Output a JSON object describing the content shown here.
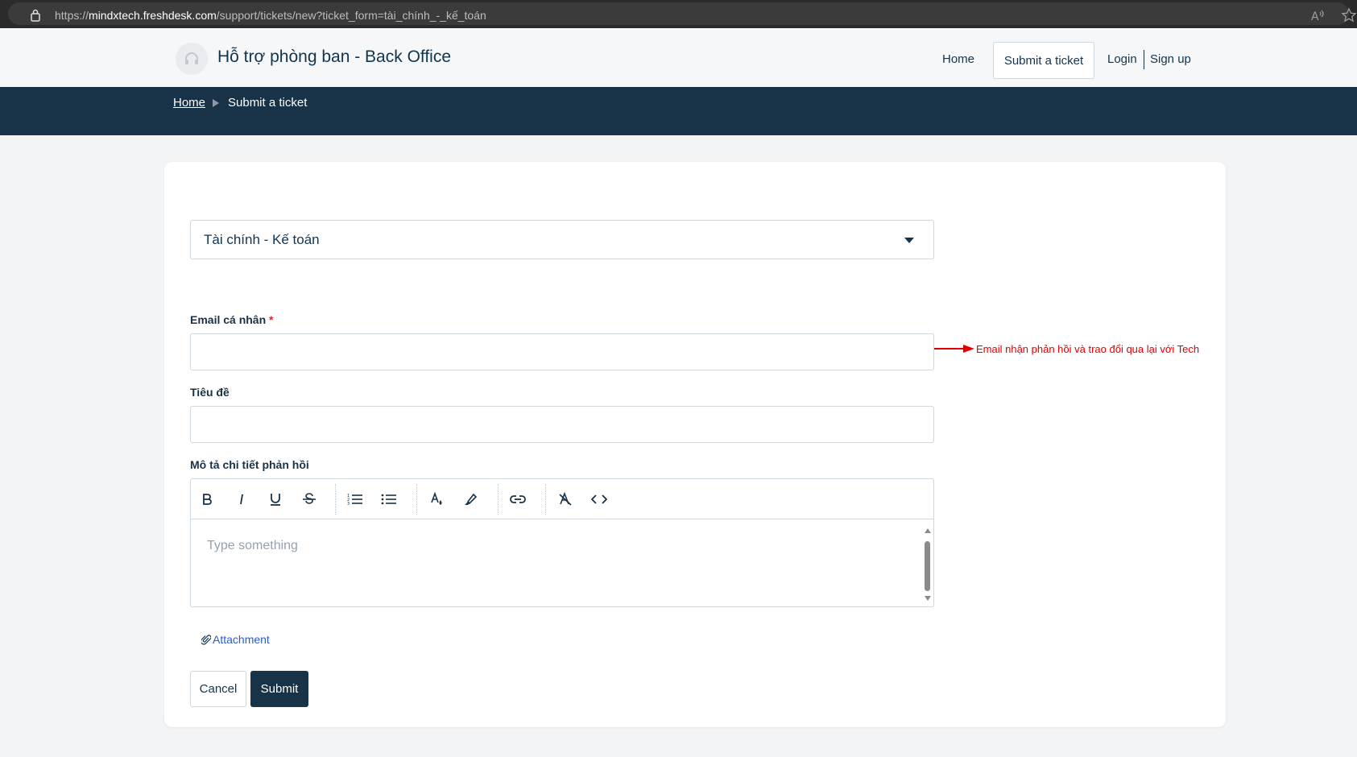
{
  "browser": {
    "url_prefix": "https://",
    "url_host": "mindxtech.freshdesk.com",
    "url_path": "/support/tickets/new?ticket_form=tài_chính_-_kế_toán",
    "icons": [
      "lock-icon",
      "read-aloud-icon",
      "favorite-star-icon"
    ]
  },
  "header": {
    "portal_title": "Hỗ trợ phòng ban - Back Office",
    "nav": {
      "home": "Home",
      "submit_ticket": "Submit a ticket",
      "login": "Login",
      "signup": "Sign up"
    },
    "logo_icon": "headset-icon"
  },
  "breadcrumb": {
    "home": "Home",
    "current": "Submit a ticket"
  },
  "form": {
    "ticket_form_select": "Tài chính - Kế toán",
    "email": {
      "label": "Email cá nhân",
      "required_mark": "*",
      "value": ""
    },
    "subject": {
      "label": "Tiêu đề",
      "value": ""
    },
    "description": {
      "label": "Mô tả chi tiết phản hồi",
      "placeholder": "Type something",
      "toolbar": [
        "bold-icon",
        "italic-icon",
        "underline-icon",
        "strikethrough-icon",
        "ordered-list-icon",
        "bullet-list-icon",
        "font-color-icon",
        "highlight-icon",
        "link-icon",
        "clear-format-icon",
        "code-view-icon"
      ]
    },
    "attachment": "Attachment",
    "cancel": "Cancel",
    "submit": "Submit"
  },
  "annotation": {
    "text": "Email nhận phản hồi và trao đổi qua lại với Tech",
    "color": "#e00000"
  },
  "colors": {
    "primary": "#183247",
    "border": "#cfd7df",
    "link": "#2c5cc5"
  }
}
